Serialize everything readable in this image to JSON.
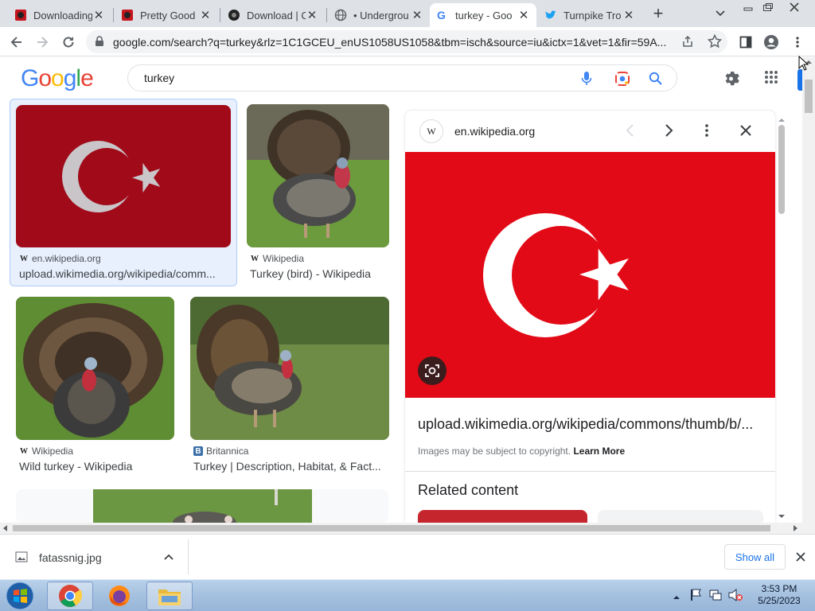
{
  "browser": {
    "tabs": [
      {
        "title": "Downloading",
        "icon": "red-torrent-icon",
        "active": false
      },
      {
        "title": "Pretty Good",
        "icon": "red-torrent-icon",
        "active": false
      },
      {
        "title": "Download | C",
        "icon": "black-circle-icon",
        "active": false
      },
      {
        "title": "• Undergrou",
        "icon": "globe-icon",
        "active": false
      },
      {
        "title": "turkey - Goo",
        "icon": "google-icon",
        "active": true
      },
      {
        "title": "Turnpike Tro",
        "icon": "twitter-icon",
        "active": false
      }
    ],
    "new_tab_symbol": "+",
    "url": "google.com/search?q=turkey&rlz=1C1GCEU_enUS1058US1058&tbm=isch&source=iu&ictx=1&vet=1&fir=59A..."
  },
  "google": {
    "logo": [
      "G",
      "o",
      "o",
      "g",
      "l",
      "e"
    ],
    "logo_colors": [
      "#4285f4",
      "#ea4335",
      "#fbbc05",
      "#4285f4",
      "#34a853",
      "#ea4335"
    ],
    "search_value": "turkey"
  },
  "results": [
    {
      "source": "en.wikipedia.org",
      "source_icon": "W",
      "title": "upload.wikimedia.org/wikipedia/comm..."
    },
    {
      "source": "Wikipedia",
      "source_icon": "W",
      "title": "Turkey (bird) - Wikipedia"
    },
    {
      "source": "Wikipedia",
      "source_icon": "W",
      "title": "Wild turkey - Wikipedia"
    },
    {
      "source": "Britannica",
      "source_icon": "B",
      "title": "Turkey | Description, Habitat, & Fact..."
    }
  ],
  "panel": {
    "site_icon": "W",
    "site": "en.wikipedia.org",
    "link": "upload.wikimedia.org/wikipedia/commons/thumb/b/...",
    "copyright": "Images may be subject to copyright.",
    "learn_more": "Learn More",
    "related": "Related content"
  },
  "download": {
    "filename": "fatassnig.jpg",
    "show_all": "Show all"
  },
  "taskbar": {
    "time": "3:53 PM",
    "date": "5/25/2023"
  },
  "colors": {
    "flag_red_dark": "#a10a19",
    "flag_red": "#e30a17",
    "accent": "#1a73e8"
  }
}
